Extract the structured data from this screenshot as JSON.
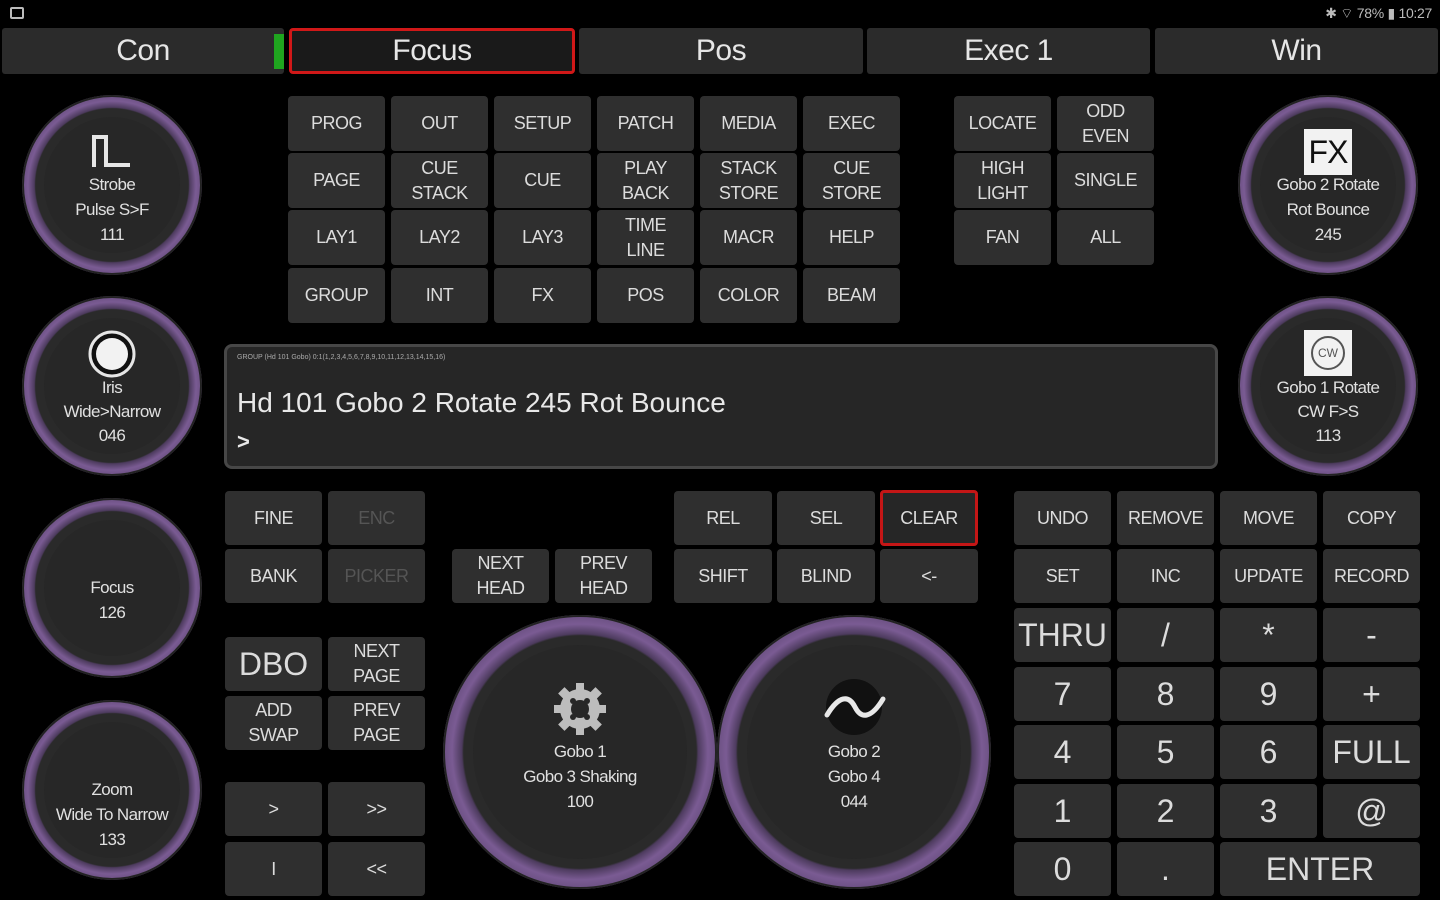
{
  "status": {
    "right_text": "✱ ⌔ 78% ▮ 10:27"
  },
  "tabs": [
    {
      "label": "Con"
    },
    {
      "label": "Focus"
    },
    {
      "label": "Pos"
    },
    {
      "label": "Exec 1"
    },
    {
      "label": "Win"
    }
  ],
  "top_grid": [
    [
      "PROG",
      "OUT",
      "SETUP",
      "PATCH",
      "MEDIA",
      "EXEC"
    ],
    [
      "PAGE",
      "CUE\nSTACK",
      "CUE",
      "PLAY\nBACK",
      "STACK\nSTORE",
      "CUE\nSTORE"
    ],
    [
      "LAY1",
      "LAY2",
      "LAY3",
      "TIME\nLINE",
      "MACR",
      "HELP"
    ],
    [
      "GROUP",
      "INT",
      "FX",
      "POS",
      "COLOR",
      "BEAM"
    ]
  ],
  "select_grid": [
    [
      "LOCATE",
      "ODD\nEVEN"
    ],
    [
      "HIGH\nLIGHT",
      "SINGLE"
    ],
    [
      "FAN",
      "ALL"
    ]
  ],
  "command": {
    "small": "GROUP (Hd 101 Gobo) 0:1(1,2,3,4,5,6,7,8,9,10,11,12,13,14,15,16)",
    "main": "Hd 101 Gobo 2 Rotate 245  Rot Bounce",
    "prompt": ">"
  },
  "left_keys": {
    "fine": "FINE",
    "enc": "ENC",
    "bank": "BANK",
    "picker": "PICKER",
    "next_head": "NEXT\nHEAD",
    "prev_head": "PREV\nHEAD",
    "dbo": "DBO",
    "next_page": "NEXT\nPAGE",
    "add_swap": "ADD\nSWAP",
    "prev_page": "PREV\nPAGE",
    "play": ">",
    "ffwd": ">>",
    "pause": "I",
    "rewind": "<<"
  },
  "mid_keys": {
    "rel": "REL",
    "sel": "SEL",
    "clear": "CLEAR",
    "shift": "SHIFT",
    "blind": "BLIND",
    "back": "<-"
  },
  "right_keys": {
    "row1": [
      "UNDO",
      "REMOVE",
      "MOVE",
      "COPY"
    ],
    "row2": [
      "SET",
      "INC",
      "UPDATE",
      "RECORD"
    ]
  },
  "keypad": {
    "thru": "THRU",
    "slash": "/",
    "star": "*",
    "minus": "-",
    "n7": "7",
    "n8": "8",
    "n9": "9",
    "plus": "+",
    "n4": "4",
    "n5": "5",
    "n6": "6",
    "full": "FULL",
    "n1": "1",
    "n2": "2",
    "n3": "3",
    "at": "@",
    "n0": "0",
    "dot": ".",
    "enter": "ENTER"
  },
  "encoders": {
    "strobe": {
      "l1": "Strobe",
      "l2": "Pulse S>F",
      "l3": "111"
    },
    "iris": {
      "l1": "Iris",
      "l2": "Wide>Narrow",
      "l3": "046"
    },
    "focus": {
      "l1": "Focus",
      "l2": "126"
    },
    "zoom": {
      "l1": "Zoom",
      "l2": "Wide To Narrow",
      "l3": "133"
    },
    "fx": {
      "icon_text": "FX",
      "l1": "Gobo 2 Rotate",
      "l2": "Rot Bounce",
      "l3": "245"
    },
    "rotate": {
      "icon_text": "CW",
      "l1": "Gobo 1 Rotate",
      "l2": "CW F>S",
      "l3": "113"
    },
    "gobo1": {
      "l1": "Gobo 1",
      "l2": "Gobo 3 Shaking",
      "l3": "100"
    },
    "gobo2": {
      "l1": "Gobo 2",
      "l2": "Gobo 4",
      "l3": "044"
    }
  }
}
